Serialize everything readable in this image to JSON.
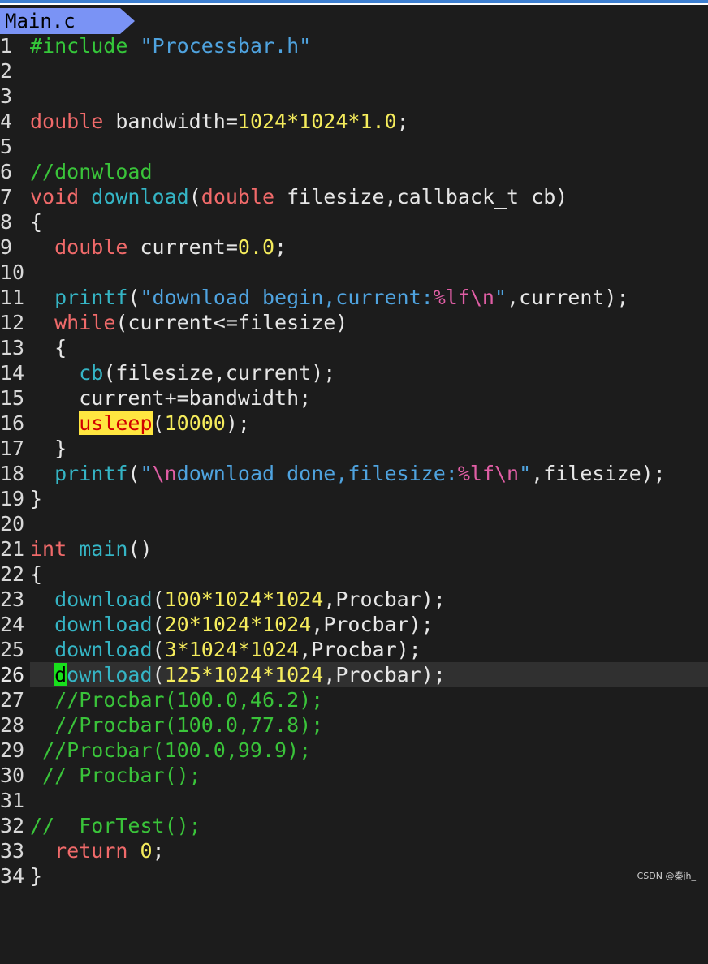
{
  "tab": {
    "filename": "Main.c"
  },
  "code": {
    "lines": [
      {
        "n": "1",
        "seg": [
          "#include ",
          "\"Processbar.h\""
        ]
      },
      {
        "n": "2",
        "seg": []
      },
      {
        "n": "3",
        "seg": []
      },
      {
        "n": "4",
        "seg": [
          "double",
          " bandwidth=",
          "1024",
          "*",
          "1024",
          "*",
          "1.0",
          ";"
        ]
      },
      {
        "n": "5",
        "seg": []
      },
      {
        "n": "6",
        "seg": [
          "//donwload"
        ]
      },
      {
        "n": "7",
        "seg": [
          "void",
          " ",
          "download",
          "(",
          "double",
          " filesize,callback_t cb)"
        ]
      },
      {
        "n": "8",
        "seg": [
          "{"
        ]
      },
      {
        "n": "9",
        "seg": [
          "  ",
          "double",
          " current=",
          "0.0",
          ";"
        ]
      },
      {
        "n": "10",
        "seg": []
      },
      {
        "n": "11",
        "seg": [
          "  ",
          "printf",
          "(",
          "\"download begin,current:",
          "%lf",
          "\\n",
          "\"",
          ",current);"
        ]
      },
      {
        "n": "12",
        "seg": [
          "  ",
          "while",
          "(current<=filesize)"
        ]
      },
      {
        "n": "13",
        "seg": [
          "  {"
        ]
      },
      {
        "n": "14",
        "seg": [
          "    ",
          "cb",
          "(filesize,current);"
        ]
      },
      {
        "n": "15",
        "seg": [
          "    current+=bandwidth;"
        ]
      },
      {
        "n": "16",
        "seg": [
          "    ",
          "usleep",
          "(",
          "10000",
          ");"
        ]
      },
      {
        "n": "17",
        "seg": [
          "  }"
        ]
      },
      {
        "n": "18",
        "seg": [
          "  ",
          "printf",
          "(",
          "\"",
          "\\n",
          "download done,filesize:",
          "%lf",
          "\\n",
          "\"",
          ",filesize);"
        ]
      },
      {
        "n": "19",
        "seg": [
          "}"
        ]
      },
      {
        "n": "20",
        "seg": []
      },
      {
        "n": "21",
        "seg": [
          "int",
          " ",
          "main",
          "()"
        ]
      },
      {
        "n": "22",
        "seg": [
          "{"
        ]
      },
      {
        "n": "23",
        "seg": [
          "  ",
          "download",
          "(",
          "100",
          "*",
          "1024",
          "*",
          "1024",
          ",Procbar);"
        ]
      },
      {
        "n": "24",
        "seg": [
          "  ",
          "download",
          "(",
          "20",
          "*",
          "1024",
          "*",
          "1024",
          ",Procbar);"
        ]
      },
      {
        "n": "25",
        "seg": [
          "  ",
          "download",
          "(",
          "3",
          "*",
          "1024",
          "*",
          "1024",
          ",Procbar);"
        ]
      },
      {
        "n": "26",
        "seg": [
          "  ",
          "d",
          "ownload",
          "(",
          "125",
          "*",
          "1024",
          "*",
          "1024",
          ",Procbar);"
        ]
      },
      {
        "n": "27",
        "seg": [
          "  ",
          "//Procbar(100.0,46.2);"
        ]
      },
      {
        "n": "28",
        "seg": [
          "  ",
          "//Procbar(100.0,77.8);"
        ]
      },
      {
        "n": "29",
        "seg": [
          " ",
          "//Procbar(100.0,99.9);"
        ]
      },
      {
        "n": "30",
        "seg": [
          " ",
          "// Procbar();"
        ]
      },
      {
        "n": "31",
        "seg": []
      },
      {
        "n": "32",
        "seg": [
          "//  ForTest();"
        ]
      },
      {
        "n": "33",
        "seg": [
          "  ",
          "return",
          " ",
          "0",
          ";"
        ]
      },
      {
        "n": "34",
        "seg": [
          "}"
        ]
      }
    ]
  },
  "watermark": "CSDN @秦jh_",
  "colors": {
    "background": "#1c1c1c",
    "tab": "#7a93f5",
    "keyword": "#f06a6a",
    "function": "#35b5c5",
    "number": "#f5ec5c",
    "string": "#4fa3df",
    "comment": "#3ac43a",
    "search_highlight": "#ffe640",
    "cursor": "#18e01c"
  }
}
